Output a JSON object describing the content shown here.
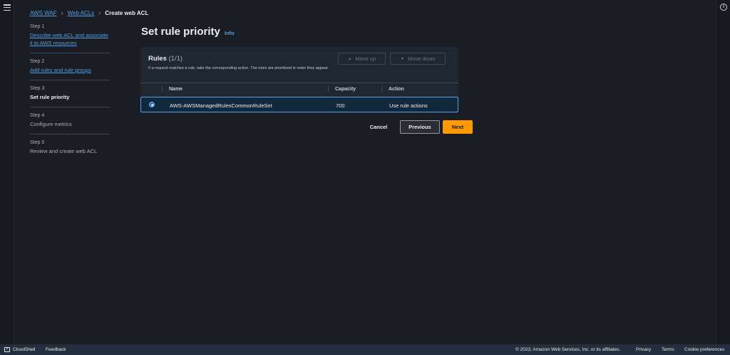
{
  "breadcrumb": {
    "items": [
      "AWS WAF",
      "Web ACLs"
    ],
    "current": "Create web ACL"
  },
  "steps": [
    {
      "num": "Step 1",
      "label": "Describe web ACL and associate it to AWS resources",
      "state": "link"
    },
    {
      "num": "Step 2",
      "label": "Add rules and rule groups",
      "state": "link"
    },
    {
      "num": "Step 3",
      "label": "Set rule priority",
      "state": "current"
    },
    {
      "num": "Step 4",
      "label": "Configure metrics",
      "state": "disabled"
    },
    {
      "num": "Step 5",
      "label": "Review and create web ACL",
      "state": "disabled"
    }
  ],
  "page": {
    "title": "Set rule priority",
    "info": "Info"
  },
  "rules": {
    "title": "Rules",
    "count": "(1/1)",
    "description": "If a request matches a rule, take the corresponding action. The rules are prioritized in order they appear.",
    "move_up": "Move up",
    "move_down": "Move down",
    "columns": [
      "Name",
      "Capacity",
      "Action"
    ],
    "rows": [
      {
        "name": "AWS-AWSManagedRulesCommonRuleSet",
        "capacity": "700",
        "action": "Use rule actions"
      }
    ]
  },
  "actions": {
    "cancel": "Cancel",
    "previous": "Previous",
    "next": "Next"
  },
  "footer": {
    "cloudshell": "CloudShell",
    "feedback": "Feedback",
    "copyright": "© 2023, Amazon Web Services, Inc. or its affiliates.",
    "privacy": "Privacy",
    "terms": "Terms",
    "cookies": "Cookie preferences"
  },
  "colors": {
    "accent": "#539fe5",
    "primary_button": "#ff9900"
  }
}
